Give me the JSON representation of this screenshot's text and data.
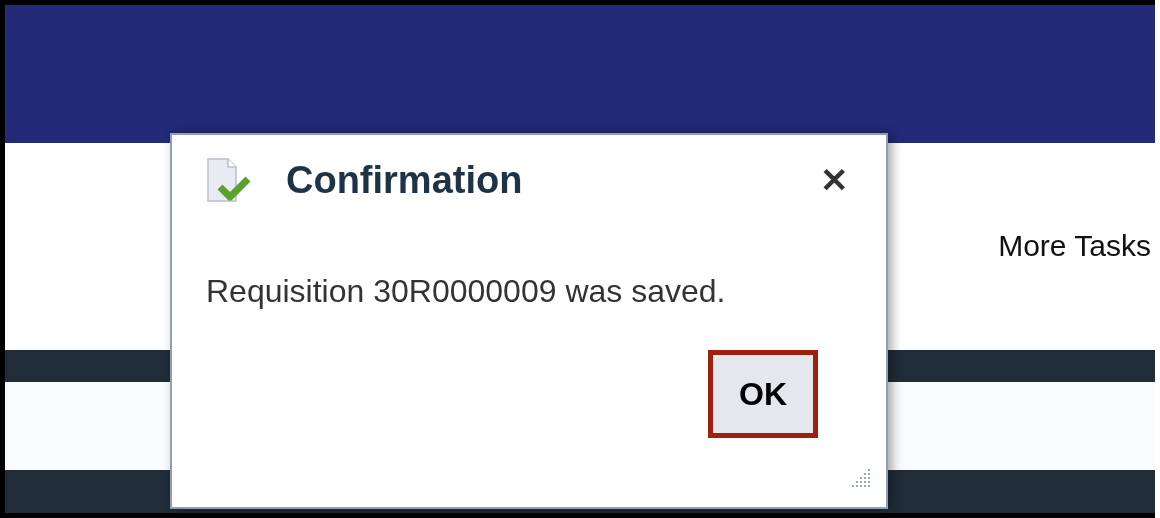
{
  "page": {
    "more_tasks_link": "More Tasks"
  },
  "dialog": {
    "title": "Confirmation",
    "close_label": "✕",
    "message": "Requisition 30R0000009 was saved.",
    "buttons": [
      {
        "label": "OK",
        "highlighted": true
      }
    ]
  }
}
